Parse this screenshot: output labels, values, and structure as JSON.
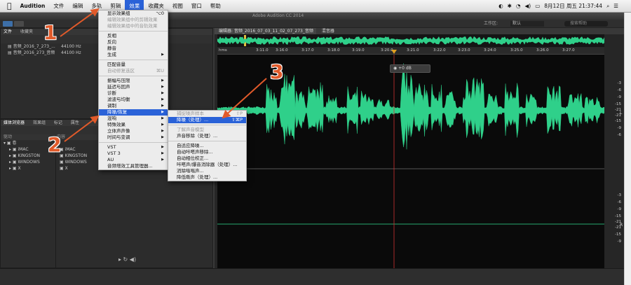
{
  "menubar": {
    "apple": "",
    "items": [
      "Audition",
      "文件",
      "编辑",
      "多轨",
      "剪辑",
      "效果",
      "收藏夹",
      "视图",
      "窗口",
      "帮助"
    ],
    "active_index": 5,
    "status_right": "8月12日 周五 21:37:44"
  },
  "window": {
    "title": "Adobe Audition CC 2014",
    "workspace_label": "工作区:",
    "workspace_value": "默认",
    "help_search_placeholder": "搜索帮助"
  },
  "files_panel": {
    "tabs": [
      "文件",
      "收藏夹"
    ],
    "files": [
      {
        "name": "音频_2016_7_273_...",
        "rate": "44100 Hz",
        "selected": false
      },
      {
        "name": "音频_2016_273_音频",
        "rate": "44100 Hz",
        "selected": true
      }
    ]
  },
  "media_panel": {
    "tabs": [
      "媒体浏览器",
      "效果组",
      "标记",
      "属性"
    ],
    "header_left": "驱动",
    "header_right": "内容",
    "tree": [
      "卷",
      "iMAC",
      "KINGSTON",
      "WINDOWS",
      "X"
    ],
    "contents": [
      "iMAC",
      "KINGSTON",
      "WINDOWS",
      "X"
    ]
  },
  "effects_menu": {
    "items": [
      {
        "label": "显示效果组",
        "shortcut": "⌥0",
        "disabled": false
      },
      {
        "label": "编辑效果组中的剪辑效果",
        "disabled": true
      },
      {
        "label": "编辑效果组中的音轨效果",
        "disabled": true
      },
      {
        "sep": true
      },
      {
        "label": "反相",
        "disabled": false
      },
      {
        "label": "反向",
        "disabled": false
      },
      {
        "label": "静音",
        "disabled": false
      },
      {
        "label": "生成",
        "arrow": true
      },
      {
        "sep": true
      },
      {
        "label": "匹配音量",
        "disabled": false
      },
      {
        "label": "自动修复选区",
        "shortcut": "⌘U",
        "disabled": true
      },
      {
        "sep": true
      },
      {
        "label": "振幅与压限",
        "arrow": true
      },
      {
        "label": "延迟与回声",
        "arrow": true
      },
      {
        "label": "诊断",
        "arrow": true
      },
      {
        "label": "滤波与均衡",
        "arrow": true
      },
      {
        "label": "调制",
        "arrow": true
      },
      {
        "label": "降噪/恢复",
        "arrow": true,
        "highlight": true
      },
      {
        "label": "混响",
        "arrow": true
      },
      {
        "label": "特殊效果",
        "arrow": true
      },
      {
        "label": "立体声声像",
        "arrow": true
      },
      {
        "label": "时间与变调",
        "arrow": true
      },
      {
        "sep": true
      },
      {
        "label": "VST",
        "arrow": true
      },
      {
        "label": "VST 3",
        "arrow": true
      },
      {
        "label": "AU",
        "arrow": true
      },
      {
        "label": "音频增效工具管理器...",
        "disabled": false
      }
    ]
  },
  "noise_menu": {
    "items": [
      {
        "label": "捕捉噪声样本",
        "shortcut": "⇧P",
        "disabled": true
      },
      {
        "label": "降噪（处理）...",
        "shortcut": "⇧⌘P",
        "highlight": true
      },
      {
        "sep": true
      },
      {
        "label": "了解声音模型",
        "disabled": true
      },
      {
        "label": "声音移除（处理）...",
        "disabled": false
      },
      {
        "sep": true
      },
      {
        "label": "自适应降噪...",
        "disabled": false
      },
      {
        "label": "自动咔嗒声移除...",
        "disabled": false
      },
      {
        "label": "自动相位校正...",
        "disabled": false
      },
      {
        "label": "咔嗒声/爆音消除器（处理）...",
        "disabled": false
      },
      {
        "label": "消除嗡嗡声...",
        "disabled": false
      },
      {
        "label": "降低嘶声（处理）...",
        "disabled": false
      }
    ]
  },
  "editor": {
    "tab_label": "编辑器: 音频_2016_07_03_11_02_07_273_音频",
    "mixer_tab": "混音器",
    "ruler_unit": "hms",
    "time_ticks": [
      "3:11.0",
      "3:16.0",
      "3:17.0",
      "3:18.0",
      "3:19.0",
      "3:20.0",
      "3:21.0",
      "3:22.0",
      "3:23.0",
      "3:24.0",
      "3:25.0",
      "3:26.0",
      "3:27.0"
    ],
    "hud_value": "+0 dB",
    "db_labels_top": [
      "-3",
      "-6",
      "-9",
      "-15",
      "-21",
      "-21",
      "-15",
      "-9",
      "-6"
    ],
    "db_labels_bottom": [
      "-3",
      "-6",
      "-9",
      "-15",
      "-21",
      "-21",
      "-15",
      "-9"
    ],
    "channel_left": "L",
    "channel_right": "R",
    "wave_color": "#2fd08a"
  },
  "annotations": {
    "n1": "1",
    "n2": "2",
    "n3": "3",
    "color": "#e15a2a"
  }
}
